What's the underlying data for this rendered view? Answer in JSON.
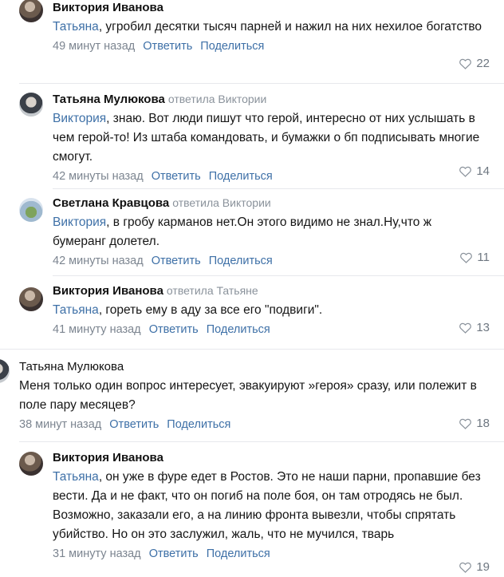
{
  "comments": [
    {
      "author": "Виктория Иванова",
      "reply_to": "",
      "mention": "Татьяна",
      "text": ", угробил десятки тысяч парней и нажил на них нехилое богатство",
      "time": "49 минут назад",
      "reply": "Ответить",
      "share": "Поделиться",
      "likes": "22"
    },
    {
      "author": "Татьяна Мулюкова",
      "reply_to": "ответила Виктории",
      "mention": "Виктория",
      "text": ", знаю. Вот люди пишут что герой, интересно от них услышать в чем герой-то! Из штаба командовать, и бумажки о бп подписывать многие смогут.",
      "time": "42 минуты назад",
      "reply": "Ответить",
      "share": "Поделиться",
      "likes": "14"
    },
    {
      "author": "Светлана Кравцова",
      "reply_to": "ответила Виктории",
      "mention": "Виктория",
      "text": ", в гробу карманов нет.Он этого видимо не знал.Ну,что ж бумеранг долетел.",
      "time": "42 минуты назад",
      "reply": "Ответить",
      "share": "Поделиться",
      "likes": "11"
    },
    {
      "author": "Виктория Иванова",
      "reply_to": "ответила Татьяне",
      "mention": "Татьяна",
      "text": ", гореть ему в аду за все его \"подвиги\".",
      "time": "41 минуту назад",
      "reply": "Ответить",
      "share": "Поделиться",
      "likes": "13"
    },
    {
      "author": "Татьяна Мулюкова",
      "reply_to": "",
      "mention": "",
      "text": "Меня только один вопрос интересует, эвакуируют »героя» сразу, или полежит в поле пару месяцев?",
      "time": "38 минут назад",
      "reply": "Ответить",
      "share": "Поделиться",
      "likes": "18"
    },
    {
      "author": "Виктория Иванова",
      "reply_to": "",
      "mention": "Татьяна",
      "text": ", он уже в фуре едет в Ростов. Это не наши парни, пропавшие без вести. Да и не факт, что он погиб на поле боя, он там отродясь не был. Возможно, заказали его, а на линию фронта вывезли, чтобы спрятать убийство. Но он это заслужил, жаль, что не мучился, тварь",
      "time": "31 минуту назад",
      "reply": "Ответить",
      "share": "Поделиться",
      "likes": "19"
    }
  ]
}
